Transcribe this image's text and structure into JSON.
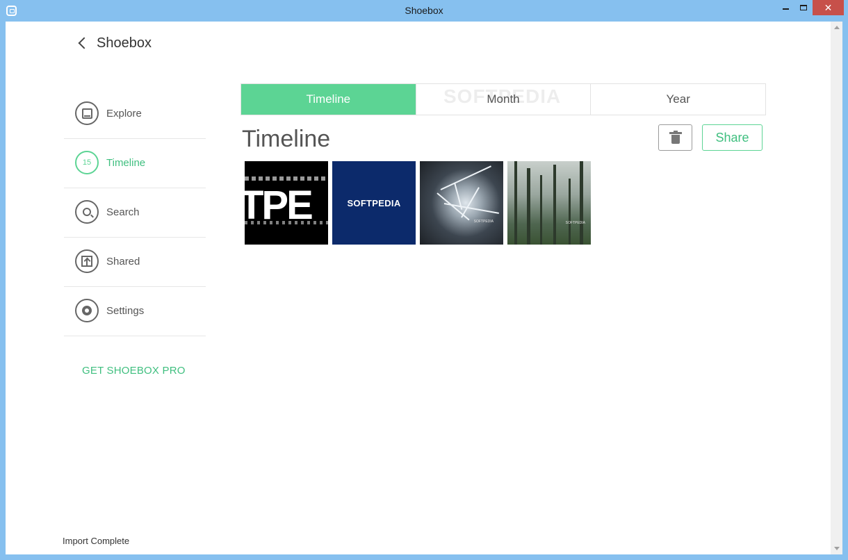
{
  "window": {
    "title": "Shoebox",
    "close_glyph": "✕"
  },
  "header": {
    "title": "Shoebox"
  },
  "sidebar": {
    "items": [
      {
        "label": "Explore",
        "icon": "explore-icon"
      },
      {
        "label": "Timeline",
        "icon": "timeline-count-badge",
        "badge": "15",
        "active": true
      },
      {
        "label": "Search",
        "icon": "search-icon"
      },
      {
        "label": "Shared",
        "icon": "share-icon"
      },
      {
        "label": "Settings",
        "icon": "gear-icon"
      }
    ],
    "promo": "GET SHOEBOX PRO"
  },
  "tabs": [
    {
      "label": "Timeline",
      "active": true
    },
    {
      "label": "Month"
    },
    {
      "label": "Year"
    }
  ],
  "watermark": "SOFTPEDIA",
  "main": {
    "title": "Timeline",
    "share_label": "Share"
  },
  "photos": [
    {
      "text": "TPE"
    },
    {
      "text": "SOFTPEDIA"
    },
    {
      "text": "SOFTPEDIA"
    },
    {
      "text": "SOFTPEDIA"
    }
  ],
  "status": "Import Complete",
  "colors": {
    "accent": "#5cd494",
    "titlebar": "#86c0ef",
    "close": "#c7504a"
  }
}
